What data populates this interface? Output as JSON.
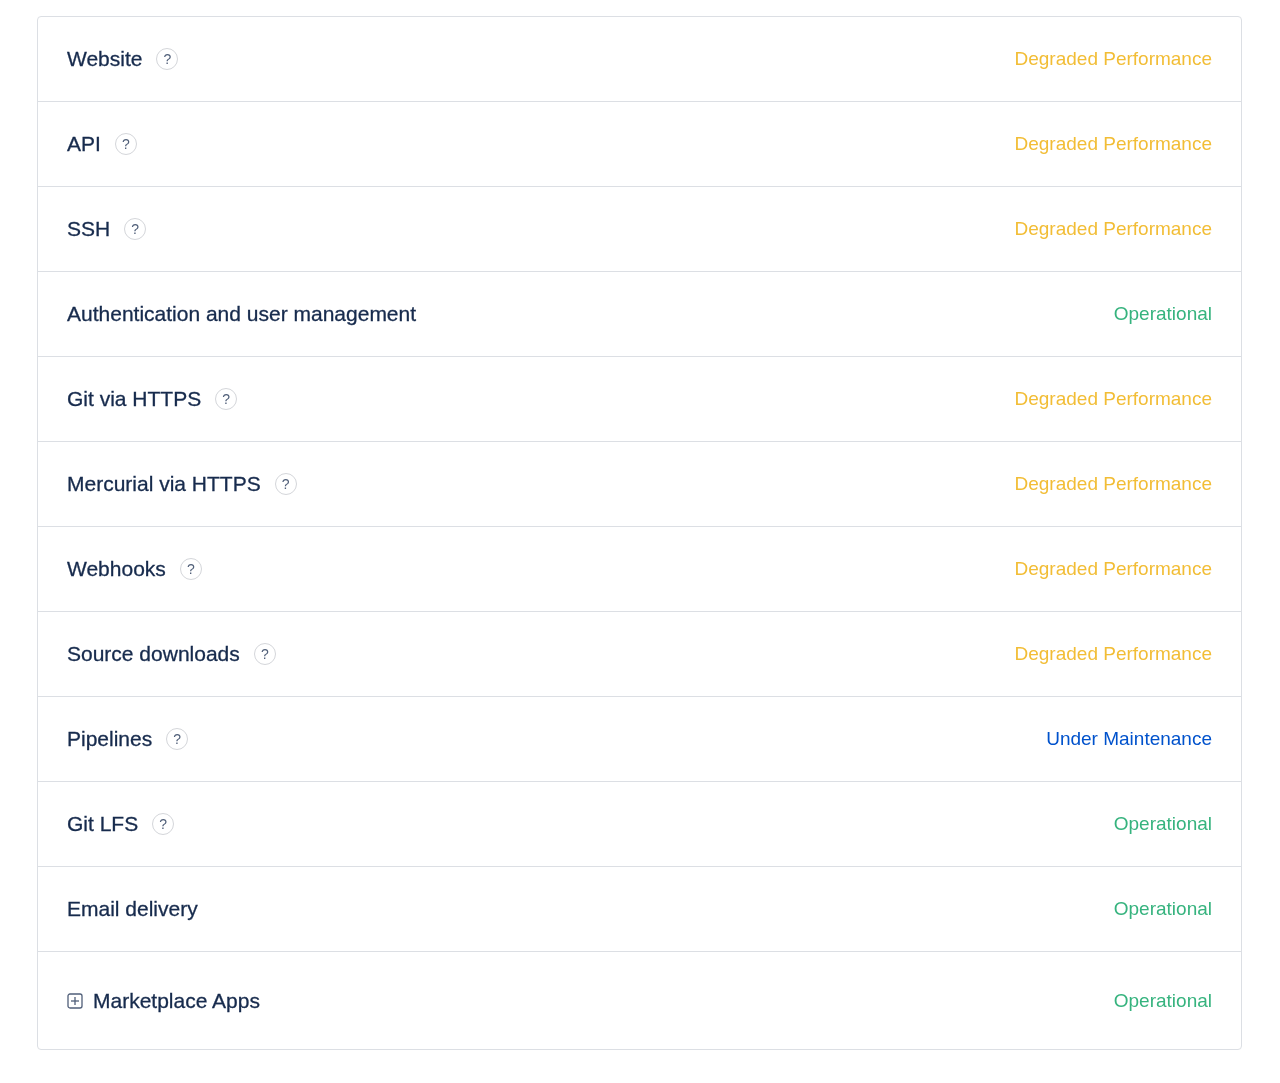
{
  "components": [
    {
      "kind": "component",
      "name": "Website",
      "help": "?",
      "status": "Degraded Performance",
      "color": "#f2bd35"
    },
    {
      "kind": "component",
      "name": "API",
      "help": "?",
      "status": "Degraded Performance",
      "color": "#f2bd35"
    },
    {
      "kind": "component",
      "name": "SSH",
      "help": "?",
      "status": "Degraded Performance",
      "color": "#f2bd35"
    },
    {
      "kind": "component",
      "name": "Authentication and user management",
      "status": "Operational",
      "color": "#36b37e"
    },
    {
      "kind": "component",
      "name": "Git via HTTPS",
      "help": "?",
      "status": "Degraded Performance",
      "color": "#f2bd35"
    },
    {
      "kind": "component",
      "name": "Mercurial via HTTPS",
      "help": "?",
      "status": "Degraded Performance",
      "color": "#f2bd35"
    },
    {
      "kind": "component",
      "name": "Webhooks",
      "help": "?",
      "status": "Degraded Performance",
      "color": "#f2bd35"
    },
    {
      "kind": "component",
      "name": "Source downloads",
      "help": "?",
      "status": "Degraded Performance",
      "color": "#f2bd35"
    },
    {
      "kind": "component",
      "name": "Pipelines",
      "help": "?",
      "status": "Under Maintenance",
      "color": "#0052cc"
    },
    {
      "kind": "component",
      "name": "Git LFS",
      "help": "?",
      "status": "Operational",
      "color": "#36b37e"
    },
    {
      "kind": "component",
      "name": "Email delivery",
      "status": "Operational",
      "color": "#36b37e"
    },
    {
      "kind": "group",
      "name": "Marketplace Apps",
      "expanded": false,
      "status": "Operational",
      "color": "#36b37e"
    }
  ]
}
